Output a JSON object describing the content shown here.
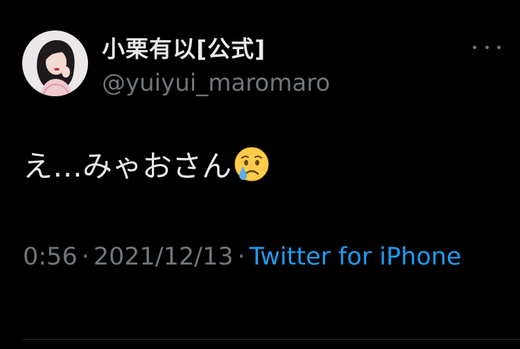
{
  "tweet": {
    "display_name": "小栗有以[公式]",
    "handle": "@yuiyui_maromaro",
    "text": "え…みゃおさん",
    "emoji": "crying-face-icon",
    "time": "0:56",
    "separator": "·",
    "date": "2021/12/13",
    "source": "Twitter for iPhone"
  },
  "colors": {
    "background": "#000000",
    "primary_text": "#e7e9ea",
    "secondary_text": "#71767b",
    "link": "#1d9bf0",
    "divider": "#2f3336"
  }
}
